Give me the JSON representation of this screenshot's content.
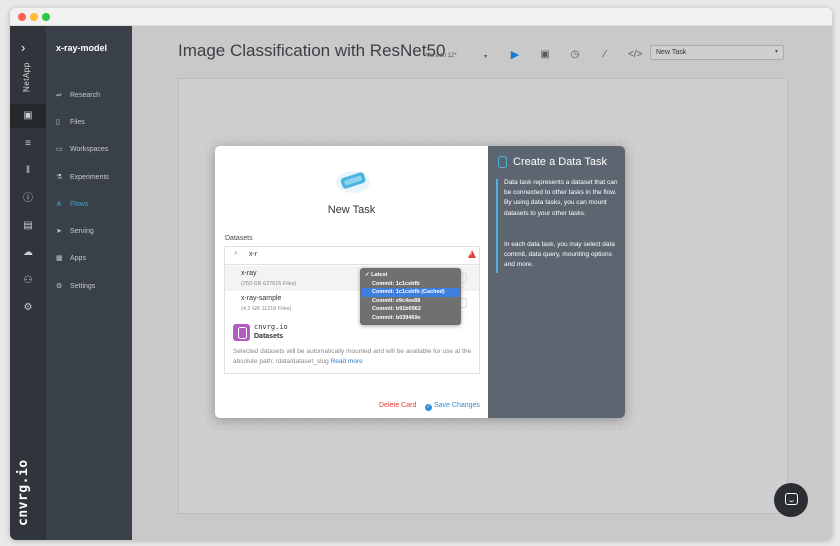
{
  "rail": {
    "brand_small": "NetApp",
    "brand_big": "cnvrg.io",
    "icons": [
      "notebook-icon",
      "database-icon",
      "library-icon",
      "info-icon",
      "package-icon",
      "cloud-icon",
      "team-icon",
      "cog-settings-icon"
    ]
  },
  "nav": {
    "project": "x-ray-model",
    "items": [
      {
        "label": "Research",
        "icon": "research-icon"
      },
      {
        "label": "Files",
        "icon": "file-icon"
      },
      {
        "label": "Workspaces",
        "icon": "workspace-icon"
      },
      {
        "label": "Experiments",
        "icon": "flask-icon"
      },
      {
        "label": "Flows",
        "icon": "flow-icon",
        "active": true
      },
      {
        "label": "Serving",
        "icon": "send-icon"
      },
      {
        "label": "Apps",
        "icon": "grid-icon"
      },
      {
        "label": "Settings",
        "icon": "gear-icon"
      }
    ]
  },
  "header": {
    "title": "Image Classification with ResNet50",
    "version": "Version 12*",
    "task_select": "New Task"
  },
  "modal": {
    "new_task": "New Task",
    "datasets_label": "Datasets",
    "search_value": "x-r",
    "datasets": [
      {
        "name": "x-ray",
        "meta": "(250 GB 627615 Files)"
      },
      {
        "name": "x-ray-sample",
        "meta": "(4.2 GB 11218 Files)"
      }
    ],
    "brand_name": "cnvrg.io",
    "brand_title": "Datasets",
    "note": "Selected datasets will be automatically mounted and will be available for use at the absolute path: /data/dataset_slug",
    "read_more": "Read more",
    "delete": "Delete Card",
    "save": "Save Changes",
    "commit_options": [
      "Latest",
      "Commit: 1c1cebfb",
      "Commit: 1c1cebfb (Cached)",
      "Commit: e9c4ee88",
      "Commit: b91b0962",
      "Commit: b039469e"
    ],
    "selected_commit_index": 2,
    "side_title": "Create a Data Task",
    "side_p1": "Data task represents a dataset that can be connected to other tasks in the flow. By using data tasks, you can mount datasets to your other tasks.",
    "side_p2": "In each data task, you may select data commit, data query, mounting options and more."
  },
  "colors": {
    "accent": "#3aa7c9",
    "primary": "#2f8ed8",
    "danger": "#e0403a",
    "selected": "#3c7fe0"
  }
}
